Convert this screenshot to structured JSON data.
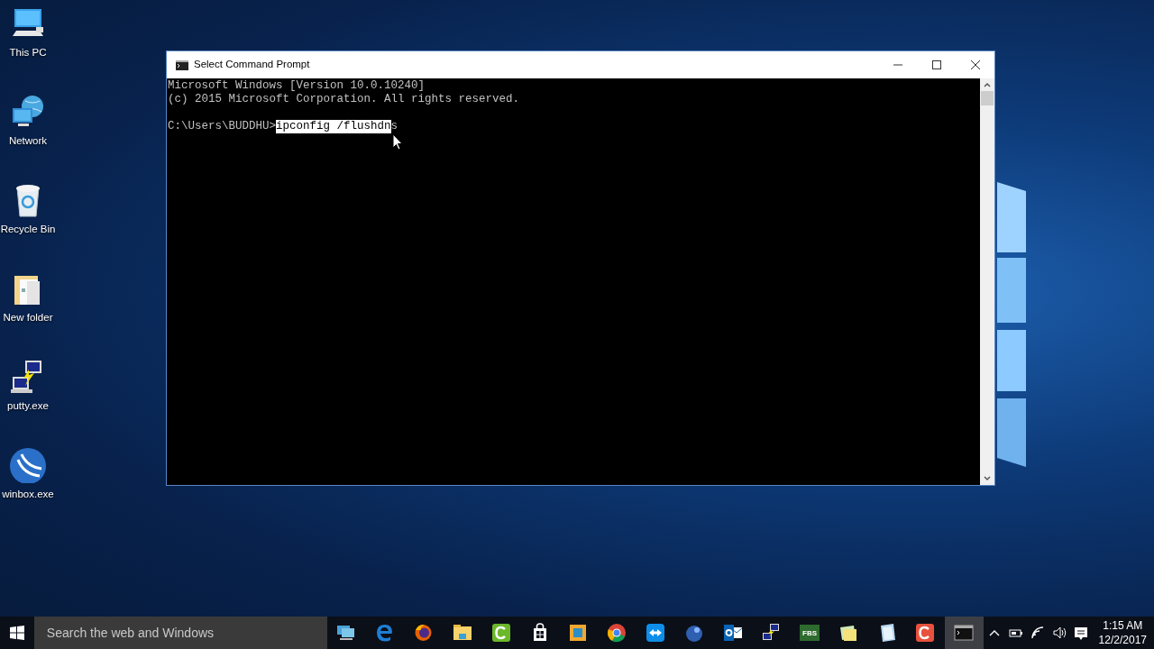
{
  "desktop_icons": [
    {
      "kind": "pc",
      "label": "This PC"
    },
    {
      "kind": "network",
      "label": "Network"
    },
    {
      "kind": "recycle",
      "label": "Recycle Bin"
    },
    {
      "kind": "folder",
      "label": "New folder"
    },
    {
      "kind": "putty",
      "label": "putty.exe"
    },
    {
      "kind": "winbox",
      "label": "winbox.exe"
    }
  ],
  "window": {
    "title": "Select Command Prompt",
    "console_lines": [
      {
        "segments": [
          {
            "text": "Microsoft Windows [Version 10.0.10240]",
            "selected": false
          }
        ]
      },
      {
        "segments": [
          {
            "text": "(c) 2015 Microsoft Corporation. All rights reserved.",
            "selected": false
          }
        ]
      },
      {
        "blank_line_before": true,
        "segments": [
          {
            "text": "C:\\Users\\BUDDHU>",
            "selected": false
          },
          {
            "text": "ipconfig /flushdn",
            "selected": true
          },
          {
            "text": "s",
            "selected": false
          }
        ]
      }
    ]
  },
  "taskbar": {
    "search": {
      "placeholder": "Search the web and Windows"
    },
    "apps": [
      {
        "kind": "monitors",
        "selected": false
      },
      {
        "kind": "edge",
        "selected": false
      },
      {
        "kind": "firefox",
        "selected": false
      },
      {
        "kind": "explorer",
        "selected": false
      },
      {
        "kind": "camtasia",
        "selected": false
      },
      {
        "kind": "store",
        "selected": false
      },
      {
        "kind": "vm",
        "selected": false
      },
      {
        "kind": "chrome",
        "selected": false
      },
      {
        "kind": "teamviewer",
        "selected": false
      },
      {
        "kind": "globe",
        "selected": false
      },
      {
        "kind": "outlook",
        "selected": false
      },
      {
        "kind": "putty",
        "selected": false
      },
      {
        "kind": "fbs",
        "selected": false,
        "label": "FBS"
      },
      {
        "kind": "notes",
        "selected": false
      },
      {
        "kind": "page",
        "selected": false
      },
      {
        "kind": "recorder",
        "selected": false
      },
      {
        "kind": "cmd",
        "selected": true
      }
    ],
    "clock": {
      "time": "1:15 AM",
      "date": "12/2/2017"
    }
  }
}
